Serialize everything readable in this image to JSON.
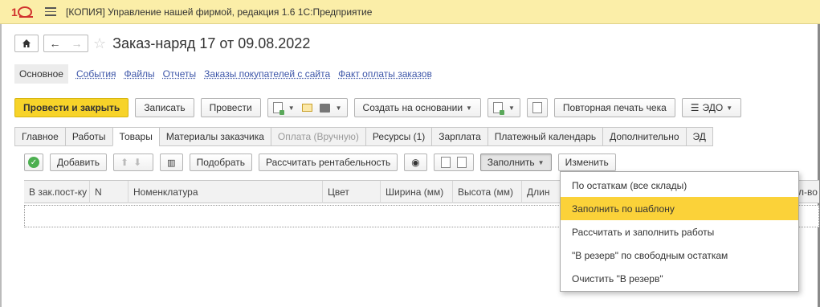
{
  "window": {
    "title": "[КОПИЯ] Управление нашей фирмой, редакция 1.6 1С:Предприятие"
  },
  "nav": {
    "back_icon": "arrow-left-icon",
    "forward_icon": "arrow-right-icon",
    "home_icon": "home-icon",
    "favorite_icon": "star-icon",
    "doc_title": "Заказ-наряд 17 от 09.08.2022"
  },
  "links": {
    "main": "Основное",
    "items": [
      "События",
      "Файлы",
      "Отчеты",
      "Заказы покупателей с сайта",
      "Факт оплаты заказов"
    ]
  },
  "toolbar": {
    "post_close": "Провести и закрыть",
    "save": "Записать",
    "post": "Провести",
    "create_based": "Создать на основании",
    "reprint_receipt": "Повторная печать чека",
    "edo": "ЭДО"
  },
  "tabs": [
    "Главное",
    "Работы",
    "Товары",
    "Материалы заказчика",
    "Оплата (Вручную)",
    "Ресурсы (1)",
    "Зарплата",
    "Платежный календарь",
    "Дополнительно",
    "ЭД"
  ],
  "active_tab": "Товары",
  "goods_toolbar": {
    "add": "Добавить",
    "pick": "Подобрать",
    "calc_profit": "Рассчитать рентабельность",
    "fill": "Заполнить",
    "change": "Изменить"
  },
  "table": {
    "columns": [
      "В зак.пост-ку",
      "N",
      "Номенклатура",
      "Цвет",
      "Ширина (мм)",
      "Высота (мм)",
      "Длин",
      "л-во"
    ]
  },
  "fill_menu": {
    "items": [
      "По остаткам (все склады)",
      "Заполнить по шаблону",
      "Рассчитать и заполнить работы",
      "\"В резерв\" по свободным остаткам",
      "Очистить \"В резерв\""
    ],
    "highlighted": "Заполнить по шаблону"
  },
  "colors": {
    "titlebar": "#fbeea8",
    "primary_button": "#f7d329",
    "menu_highlight": "#fbd239",
    "link": "#3c55a8"
  }
}
